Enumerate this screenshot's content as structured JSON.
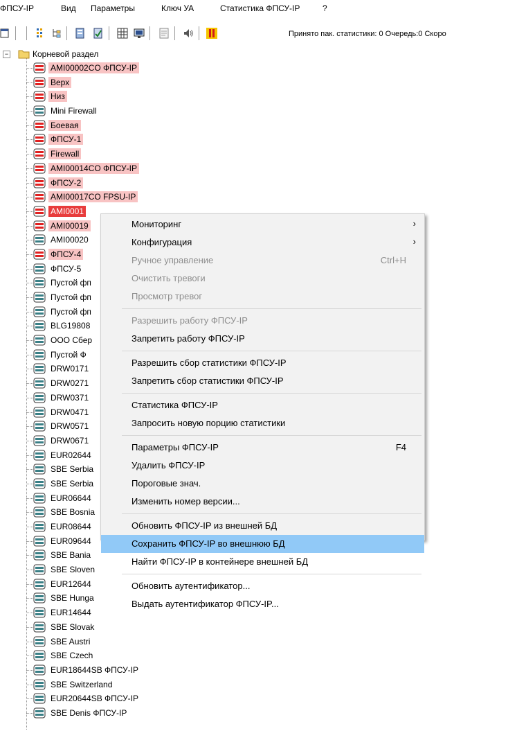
{
  "menubar": [
    "ФПСУ-IP",
    "Вид",
    "Параметры",
    "Ключ УА",
    "Статистика ФПСУ-IP",
    "?"
  ],
  "toolbar": {
    "icons": [
      "window-icon",
      "list-view-icon",
      "tree-view-icon",
      "book-icon",
      "book-check-icon",
      "grid-icon",
      "monitor-icon",
      "document-icon",
      "sound-icon",
      "pause-icon"
    ],
    "status": "Принято пак. статистики: 0 Очередь:0 Скоро"
  },
  "tree": {
    "root_label": "Корневой раздел",
    "nodes": [
      {
        "label": "AMI00002CO ФПСУ-IP",
        "state": "pink",
        "icon": "red"
      },
      {
        "label": "Верх",
        "state": "pink",
        "icon": "red"
      },
      {
        "label": "Низ",
        "state": "pink",
        "icon": "red"
      },
      {
        "label": "Mini Firewall",
        "state": "none",
        "icon": "teal"
      },
      {
        "label": "Боевая",
        "state": "pink",
        "icon": "red"
      },
      {
        "label": "ФПСУ-1",
        "state": "pink",
        "icon": "red"
      },
      {
        "label": "Firewall",
        "state": "pink",
        "icon": "red"
      },
      {
        "label": "AMI00014CO ФПСУ-IP",
        "state": "pink",
        "icon": "red"
      },
      {
        "label": "ФПСУ-2",
        "state": "pink",
        "icon": "red"
      },
      {
        "label": "AMI00017CO FPSU-IP",
        "state": "pink",
        "icon": "red"
      },
      {
        "label": "AMI0001",
        "state": "red",
        "icon": "red"
      },
      {
        "label": "AMI00019",
        "state": "pink",
        "icon": "red"
      },
      {
        "label": "AMI00020",
        "state": "none",
        "icon": "teal"
      },
      {
        "label": "ФПСУ-4",
        "state": "pink",
        "icon": "red"
      },
      {
        "label": "ФПСУ-5",
        "state": "none",
        "icon": "teal"
      },
      {
        "label": "Пустой фп",
        "state": "none",
        "icon": "teal"
      },
      {
        "label": "Пустой фп",
        "state": "none",
        "icon": "teal"
      },
      {
        "label": "Пустой фп",
        "state": "none",
        "icon": "teal"
      },
      {
        "label": "BLG19808",
        "state": "none",
        "icon": "teal"
      },
      {
        "label": "ООО Сбер",
        "state": "none",
        "icon": "teal"
      },
      {
        "label": "Пустой Ф",
        "state": "none",
        "icon": "teal"
      },
      {
        "label": "DRW0171",
        "state": "none",
        "icon": "teal"
      },
      {
        "label": "DRW0271",
        "state": "none",
        "icon": "teal"
      },
      {
        "label": "DRW0371",
        "state": "none",
        "icon": "teal"
      },
      {
        "label": "DRW0471",
        "state": "none",
        "icon": "teal"
      },
      {
        "label": "DRW0571",
        "state": "none",
        "icon": "teal"
      },
      {
        "label": "DRW0671",
        "state": "none",
        "icon": "teal"
      },
      {
        "label": "EUR02644",
        "state": "none",
        "icon": "teal"
      },
      {
        "label": "SBE Serbia",
        "state": "none",
        "icon": "teal"
      },
      {
        "label": "SBE Serbia",
        "state": "none",
        "icon": "teal"
      },
      {
        "label": "EUR06644",
        "state": "none",
        "icon": "teal"
      },
      {
        "label": "SBE Bosnia",
        "state": "none",
        "icon": "teal"
      },
      {
        "label": "EUR08644",
        "state": "none",
        "icon": "teal"
      },
      {
        "label": "EUR09644",
        "state": "none",
        "icon": "teal"
      },
      {
        "label": "SBE Bania",
        "state": "none",
        "icon": "teal"
      },
      {
        "label": "SBE Sloven",
        "state": "none",
        "icon": "teal"
      },
      {
        "label": "EUR12644",
        "state": "none",
        "icon": "teal"
      },
      {
        "label": "SBE Hunga",
        "state": "none",
        "icon": "teal"
      },
      {
        "label": "EUR14644",
        "state": "none",
        "icon": "teal"
      },
      {
        "label": "SBE Slovak",
        "state": "none",
        "icon": "teal"
      },
      {
        "label": "SBE Austri",
        "state": "none",
        "icon": "teal"
      },
      {
        "label": "SBE Czech",
        "state": "none",
        "icon": "teal"
      },
      {
        "label": "EUR18644SB ФПСУ-IP",
        "state": "none",
        "icon": "teal"
      },
      {
        "label": "SBE Switzerland",
        "state": "none",
        "icon": "teal"
      },
      {
        "label": "EUR20644SB ФПСУ-IP",
        "state": "none",
        "icon": "teal"
      },
      {
        "label": "SBE Denis ФПСУ-IP",
        "state": "none",
        "icon": "teal"
      }
    ]
  },
  "context_menu": {
    "items": [
      {
        "label": "Мониторинг",
        "submenu": true
      },
      {
        "label": "Конфигурация",
        "submenu": true
      },
      {
        "label": "Ручное управление",
        "shortcut": "Ctrl+H",
        "disabled": true
      },
      {
        "label": "Очистить тревоги",
        "disabled": true
      },
      {
        "label": "Просмотр тревог",
        "disabled": true
      },
      {
        "separator": true
      },
      {
        "label": "Разрешить работу ФПСУ-IP",
        "disabled": true
      },
      {
        "label": "Запретить работу ФПСУ-IP"
      },
      {
        "separator": true
      },
      {
        "label": "Разрешить сбор статистики ФПСУ-IP"
      },
      {
        "label": "Запретить сбор статистики ФПСУ-IP"
      },
      {
        "separator": true
      },
      {
        "label": "Статистика ФПСУ-IP"
      },
      {
        "label": "Запросить новую порцию статистики"
      },
      {
        "separator": true
      },
      {
        "label": "Параметры ФПСУ-IP",
        "shortcut": "F4"
      },
      {
        "label": "Удалить ФПСУ-IP"
      },
      {
        "label": "Пороговые знач."
      },
      {
        "label": "Изменить номер версии..."
      },
      {
        "separator": true
      },
      {
        "label": "Обновить ФПСУ-IP из внешней БД"
      },
      {
        "label": "Сохранить ФПСУ-IP во внешнюю БД",
        "highlighted": true
      },
      {
        "label": "Найти ФПСУ-IP в контейнере внешней БД"
      },
      {
        "separator": true
      },
      {
        "label": "Обновить аутентификатор..."
      },
      {
        "label": "Выдать аутентификатор ФПСУ-IP..."
      }
    ]
  },
  "colors": {
    "pink_highlight": "#f8c3c3",
    "red_selection": "#e83c3c",
    "menu_highlight": "#91c9f7",
    "teal_icon": "#3a7f86",
    "red_icon": "#e02020"
  }
}
